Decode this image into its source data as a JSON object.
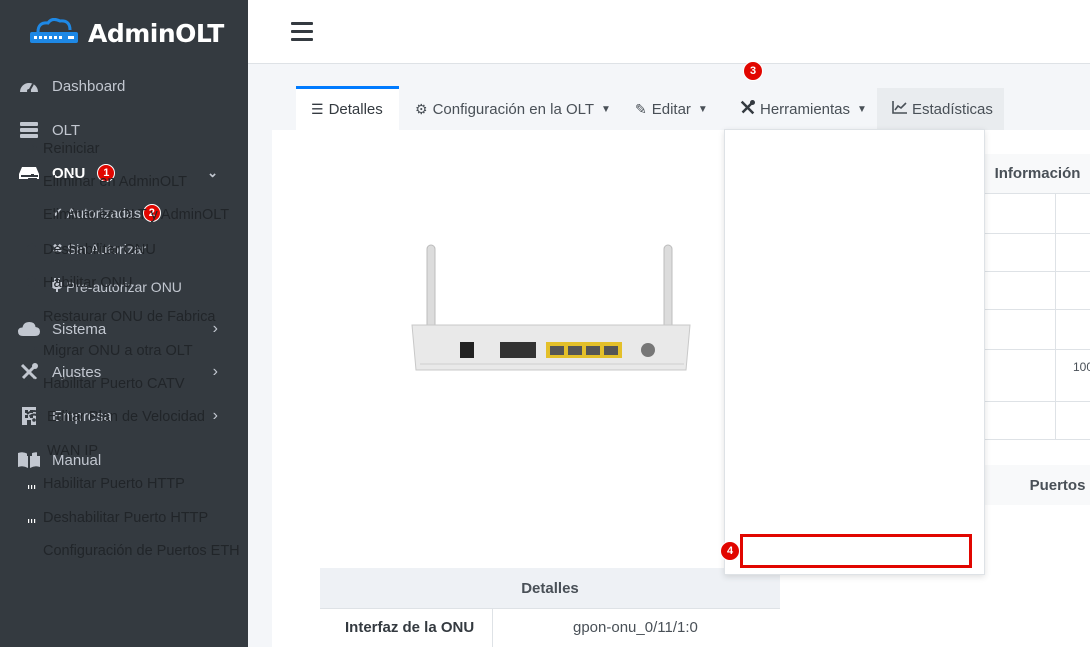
{
  "brand": {
    "name": "AdminOLT"
  },
  "sidebar": {
    "items": [
      {
        "label": "Dashboard",
        "icon": "dashboard-icon"
      },
      {
        "label": "OLT",
        "icon": "server-icon"
      },
      {
        "label": "ONU",
        "icon": "hdd-icon",
        "badge": "1"
      },
      {
        "label": "Sistema",
        "icon": "cloud-icon"
      },
      {
        "label": "Ajustes",
        "icon": "tools-icon"
      },
      {
        "label": "Empresa",
        "icon": "building-icon"
      },
      {
        "label": "Manual",
        "icon": "book-icon"
      }
    ],
    "onu_sub": [
      {
        "label": "Autorizadas",
        "icon": "check-icon",
        "badge": "2"
      },
      {
        "label": "Sin Autorizar",
        "icon": "times-icon"
      },
      {
        "label": "Pre-autorizar ONU",
        "icon": "plug-icon"
      }
    ]
  },
  "tabs": [
    {
      "label": "Detalles",
      "icon": "list-icon"
    },
    {
      "label": "Configuración en la OLT",
      "icon": "cog-icon"
    },
    {
      "label": "Editar",
      "icon": "edit-icon"
    },
    {
      "label": "Herramientas",
      "icon": "tools-icon",
      "badge": "3"
    },
    {
      "label": "Estadísticas",
      "icon": "chart-line-icon"
    }
  ],
  "dropdown": {
    "items": [
      {
        "label": "Reiniciar",
        "icon": "sync-icon"
      },
      {
        "label": "Eliminar en AdminOLT",
        "icon": "trash-icon"
      },
      {
        "label": "Eliminar en OLT y AdminOLT",
        "icon": "trash-icon"
      },
      {
        "label": "Deshabilitar ONU",
        "icon": "power-icon"
      },
      {
        "label": "Habilitar ONU",
        "icon": "power-icon"
      },
      {
        "label": "Restaurar ONU de Fabrica",
        "icon": "redo-icon"
      },
      {
        "label": "Migrar ONU a otra OLT",
        "icon": "exchange-icon"
      },
      {
        "label": "Habilitar Puerto CATV",
        "icon": "power-icon"
      },
      {
        "label": "Editar Plan de Velocidad",
        "icon": "wifi-icon"
      },
      {
        "label": "WAN IP",
        "icon": "network-icon"
      },
      {
        "label": "Habilitar Puerto HTTP",
        "icon": "ethernet-icon"
      },
      {
        "label": "Deshabilitar Puerto HTTP",
        "icon": "ethernet-icon"
      },
      {
        "label": "Configuración de Puertos ETH",
        "icon": "grid-icon",
        "badge": "4"
      }
    ]
  },
  "info": {
    "title": "Información",
    "partial_value": "100"
  },
  "ports": {
    "title": "Puertos"
  },
  "details": {
    "title": "Detalles",
    "rows": [
      {
        "label": "Interfaz de la ONU",
        "value": "gpon-onu_0/11/1:0"
      }
    ]
  }
}
